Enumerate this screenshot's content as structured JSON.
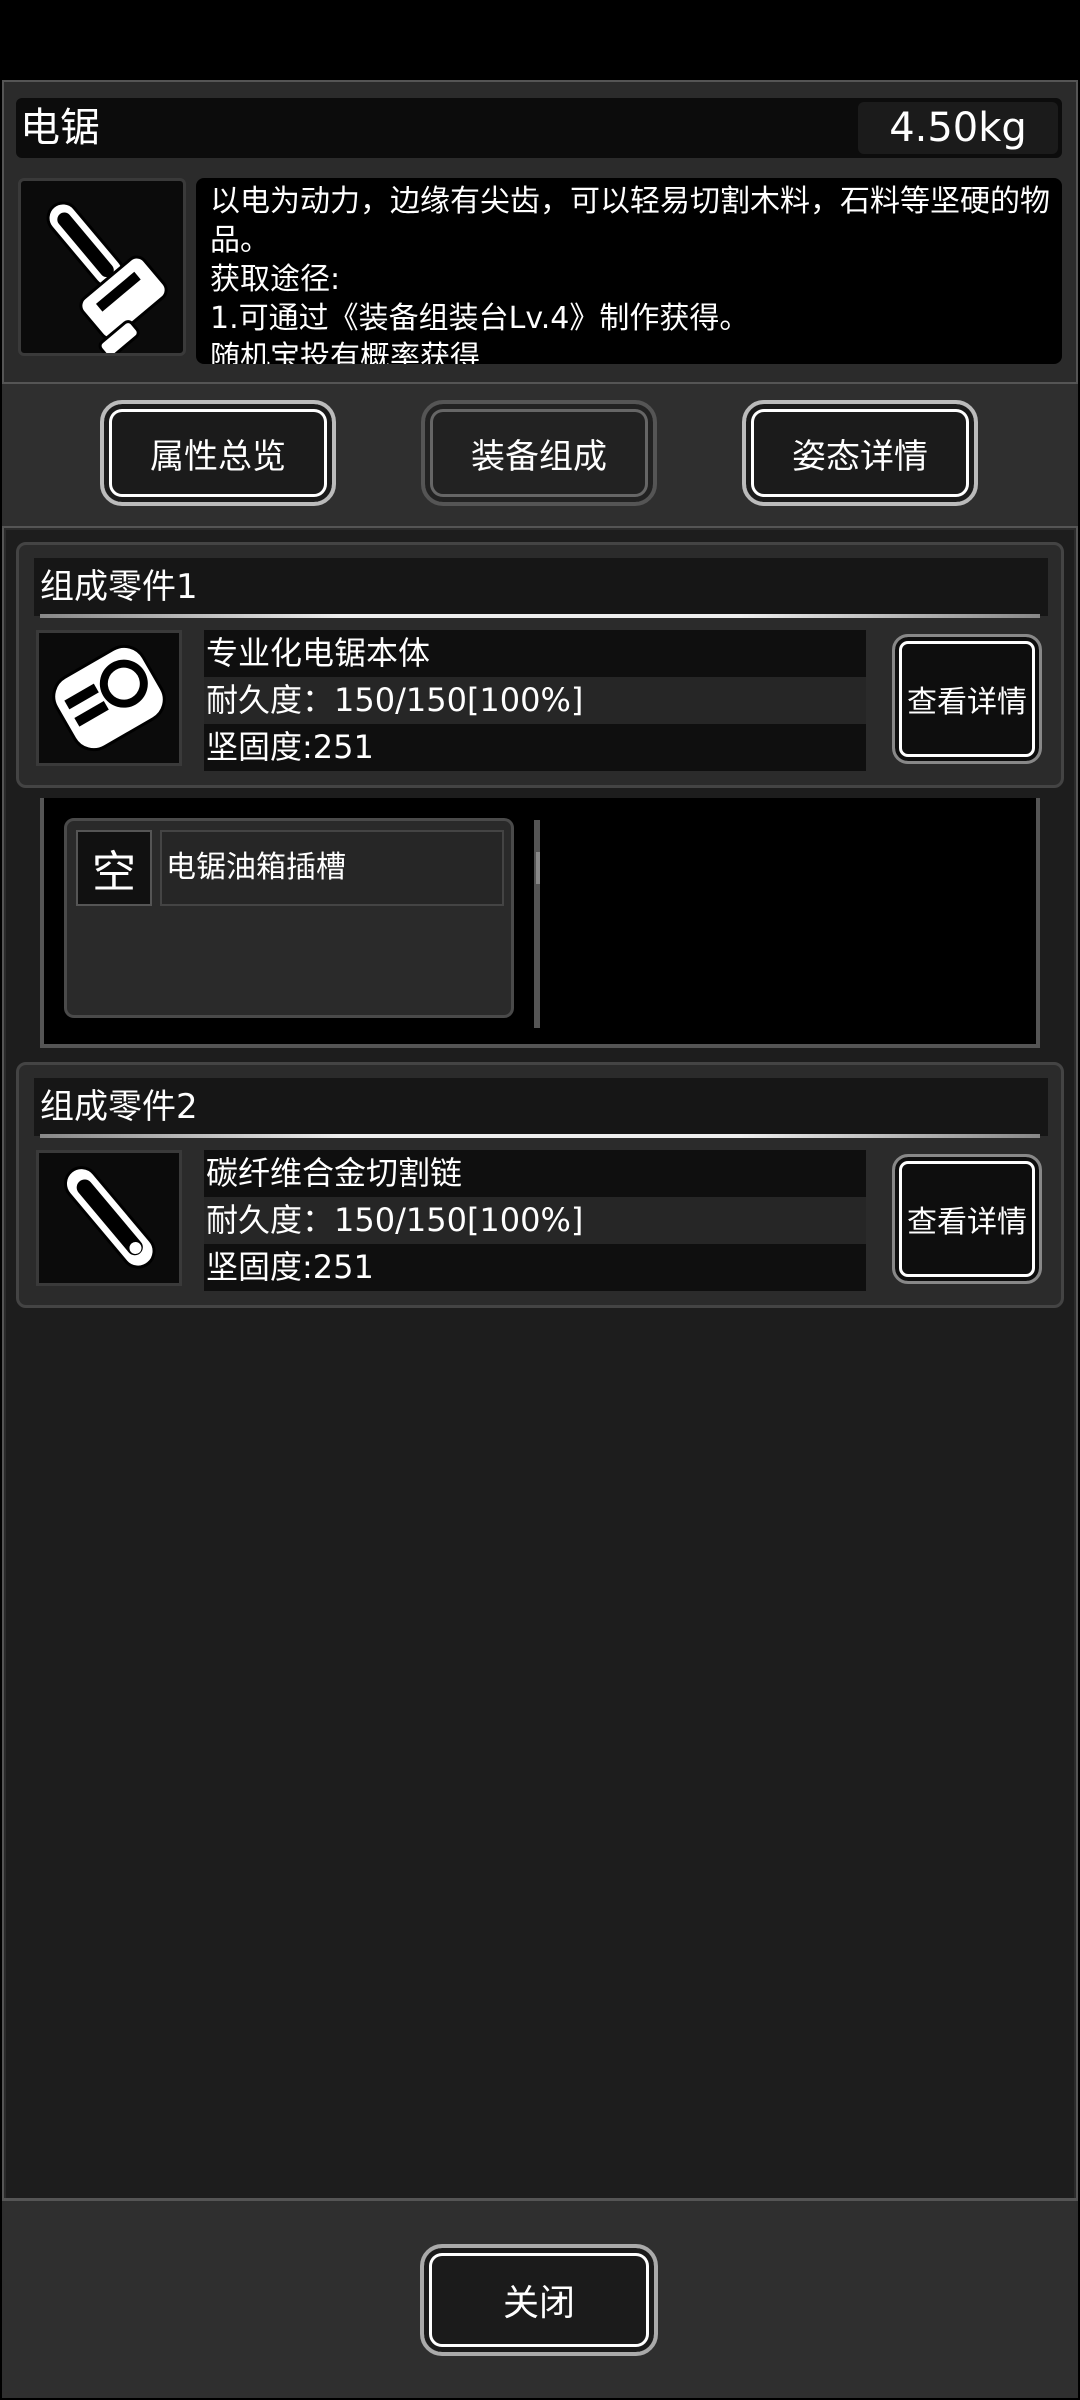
{
  "item": {
    "name": "电锯",
    "weight": "4.50kg",
    "description": [
      "以电为动力，边缘有尖齿，可以轻易切割木料，石料等坚硬的物",
      "品。",
      "获取途径:",
      "1.可通过《装备组装台Lv.4》制作获得。",
      "随机宝投有概率获得"
    ]
  },
  "tabs": [
    {
      "label": "属性总览"
    },
    {
      "label": "装备组成"
    },
    {
      "label": "姿态详情"
    }
  ],
  "parts": [
    {
      "header": "组成零件1",
      "name": "专业化电锯本体",
      "durability": "耐久度：150/150[100%]",
      "hardness": "坚固度:251",
      "detail_label": "查看详情",
      "icon": "chainsaw-body-icon"
    },
    {
      "header": "组成零件2",
      "name": "碳纤维合金切割链",
      "durability": "耐久度：150/150[100%]",
      "hardness": "坚固度:251",
      "detail_label": "查看详情",
      "icon": "cutting-chain-icon"
    }
  ],
  "slot": {
    "status": "空",
    "name": "电锯油箱插槽"
  },
  "footer": {
    "close_label": "关闭"
  },
  "item_icon": "chainsaw-icon"
}
